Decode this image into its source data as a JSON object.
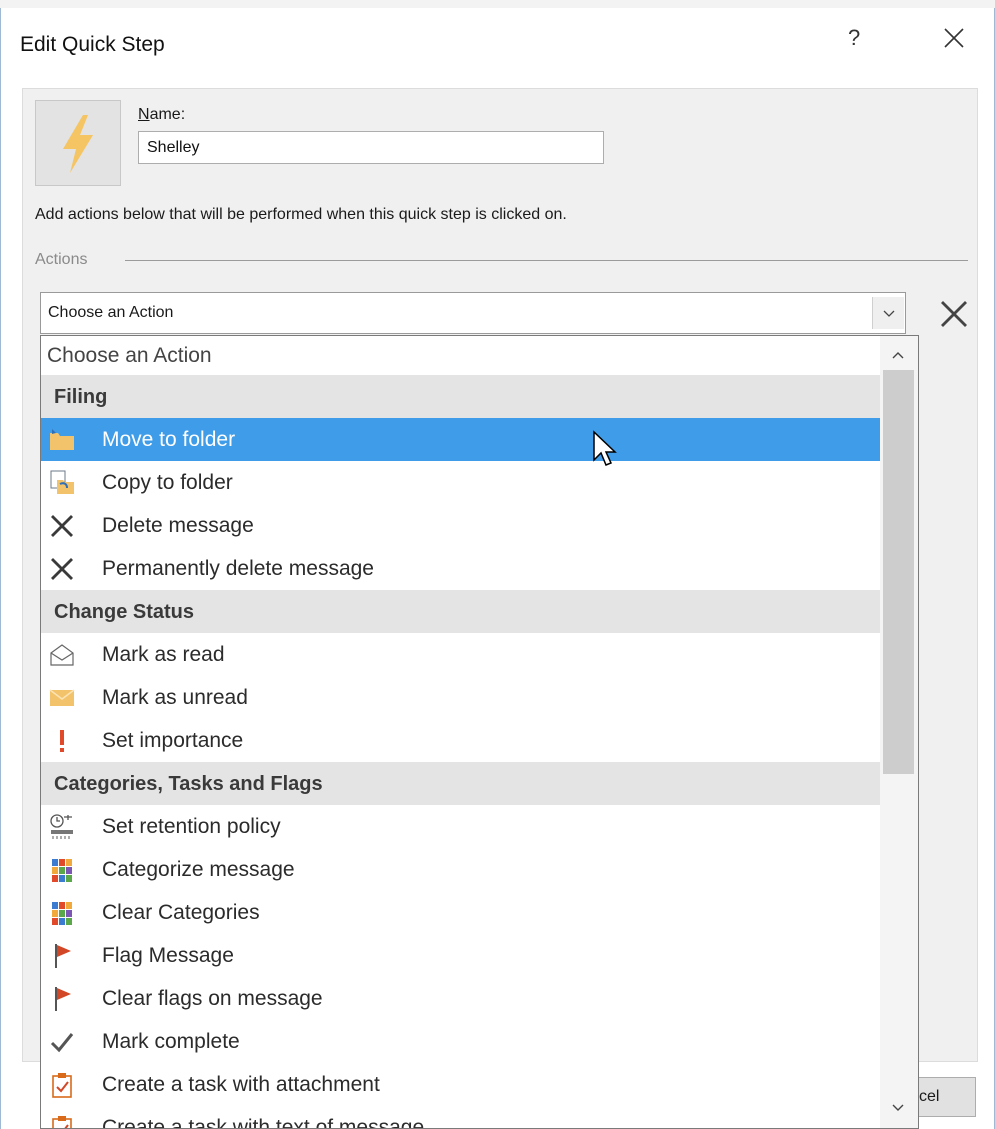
{
  "dialog": {
    "title": "Edit Quick Step",
    "help": "?",
    "name_label_accel": "N",
    "name_label_rest": "ame:",
    "name_value": "Shelley",
    "instruction": "Add actions below that will be performed when this quick step is clicked on.",
    "actions_label": "Actions",
    "combo_value": "Choose an Action",
    "cancel_partial": "cel"
  },
  "dropdown": {
    "items": [
      {
        "label": "Choose an Action",
        "kind": "first"
      },
      {
        "label": "Filing",
        "kind": "header"
      },
      {
        "label": "Move to folder",
        "kind": "item",
        "icon": "folder-move-icon",
        "selected": true
      },
      {
        "label": "Copy to folder",
        "kind": "item",
        "icon": "folder-copy-icon"
      },
      {
        "label": "Delete message",
        "kind": "item",
        "icon": "delete-x-icon"
      },
      {
        "label": "Permanently delete message",
        "kind": "item",
        "icon": "delete-x-icon"
      },
      {
        "label": "Change Status",
        "kind": "header"
      },
      {
        "label": "Mark as read",
        "kind": "item",
        "icon": "open-envelope-icon"
      },
      {
        "label": "Mark as unread",
        "kind": "item",
        "icon": "closed-envelope-icon"
      },
      {
        "label": "Set importance",
        "kind": "item",
        "icon": "exclamation-icon"
      },
      {
        "label": "Categories, Tasks and Flags",
        "kind": "header"
      },
      {
        "label": "Set retention policy",
        "kind": "item",
        "icon": "retention-clock-icon"
      },
      {
        "label": "Categorize message",
        "kind": "item",
        "icon": "category-grid-icon"
      },
      {
        "label": "Clear Categories",
        "kind": "item",
        "icon": "category-grid-icon"
      },
      {
        "label": "Flag Message",
        "kind": "item",
        "icon": "red-flag-icon"
      },
      {
        "label": "Clear flags on message",
        "kind": "item",
        "icon": "red-flag-icon"
      },
      {
        "label": "Mark complete",
        "kind": "item",
        "icon": "checkmark-icon"
      },
      {
        "label": "Create a task with attachment",
        "kind": "item",
        "icon": "task-clipboard-icon"
      },
      {
        "label": "Create a task with text of message",
        "kind": "item",
        "icon": "task-clipboard-icon"
      }
    ]
  },
  "colors": {
    "selection": "#3f9ce8",
    "header_bg": "#e4e4e4",
    "flag": "#d24726",
    "importance": "#e04a2a",
    "bolt": "#f5c463"
  }
}
